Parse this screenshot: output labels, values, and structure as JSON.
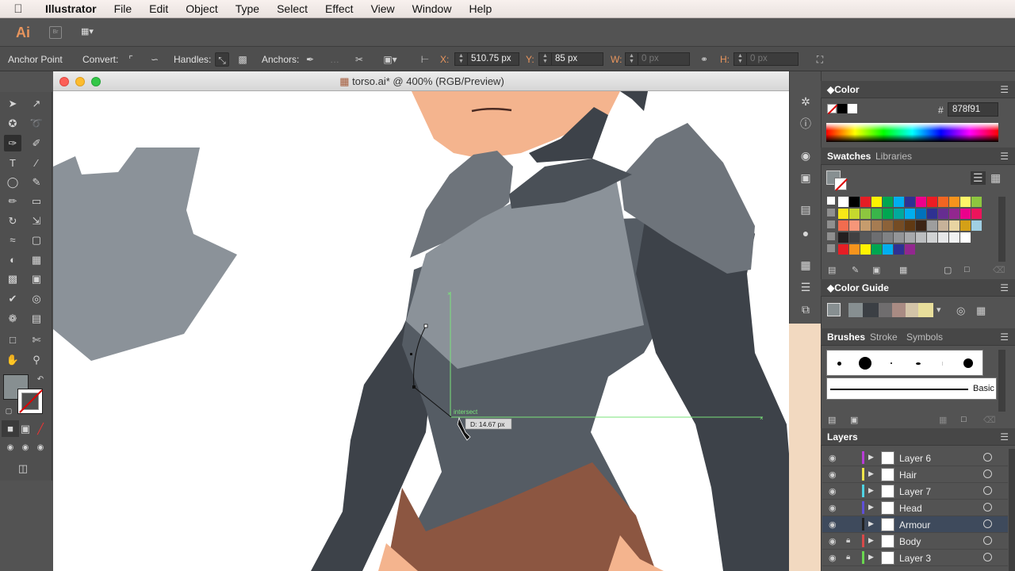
{
  "menubar": {
    "app": "Illustrator",
    "items": [
      "File",
      "Edit",
      "Object",
      "Type",
      "Select",
      "Effect",
      "View",
      "Window",
      "Help"
    ]
  },
  "appbar": {
    "logo": "Ai",
    "bridge": "Br"
  },
  "control": {
    "anchor_point": "Anchor Point",
    "convert": "Convert:",
    "handles": "Handles:",
    "anchors": "Anchors:",
    "x_label": "X:",
    "x_value": "510.75 px",
    "y_label": "Y:",
    "y_value": "85 px",
    "w_label": "W:",
    "w_value": "0 px",
    "h_label": "H:",
    "h_value": "0 px"
  },
  "document": {
    "title": "torso.ai* @ 400% (RGB/Preview)"
  },
  "canvas": {
    "smart_guide": "intersect",
    "measure": "D: 14.67 px",
    "colors": {
      "skin": "#f4b48e",
      "armor_dark": "#3d4249",
      "armor_mid": "#555c64",
      "armor_light": "#8b9299",
      "shorts": "#8c5641",
      "guide": "#7ae37a"
    }
  },
  "color_panel": {
    "title": "Color",
    "hex_label": "#",
    "hex_value": "878f91"
  },
  "swatches_panel": {
    "tab_active": "Swatches",
    "tab_other": "Libraries",
    "colors": [
      [
        "#ffffff",
        "#000000",
        "#e51e25",
        "#fff200",
        "#00a651",
        "#00aeef",
        "#2e3192",
        "#ec008c",
        "#ed1c24",
        "#f26522",
        "#f7941d",
        "#fff568",
        "#8dc63f"
      ],
      [
        "#f7e717",
        "#c5d92d",
        "#8dc63f",
        "#39b54a",
        "#00a651",
        "#00a99d",
        "#00aeef",
        "#0072bc",
        "#2e3192",
        "#662d91",
        "#92278f",
        "#ec008c",
        "#ed145b"
      ],
      [
        "#f26c4f",
        "#f69679",
        "#c69c6d",
        "#a67c52",
        "#8c6239",
        "#754c24",
        "#603913",
        "#3c2415",
        "#9e9e9e",
        "#c7b299",
        "#e8d4a2",
        "#d4a017",
        "#a0cfe3"
      ],
      [
        "#231f20",
        "#414042",
        "#58595b",
        "#6d6e71",
        "#808285",
        "#939598",
        "#a7a9ac",
        "#bcbec0",
        "#d1d3d4",
        "#e6e7e8",
        "#f1f2f2",
        "#ffffff"
      ],
      [
        "#e51e25",
        "#f7941d",
        "#fff200",
        "#00a651",
        "#00aeef",
        "#2e3192",
        "#92278f"
      ]
    ]
  },
  "color_guide": {
    "title": "Color Guide"
  },
  "brushes": {
    "tab_active": "Brushes",
    "tab2": "Stroke",
    "tab3": "Symbols",
    "basic": "Basic"
  },
  "layers": {
    "title": "Layers",
    "items": [
      {
        "name": "Layer 6",
        "color": "#b83cd6",
        "locked": false,
        "selected": false
      },
      {
        "name": "Hair",
        "color": "#f0e64a",
        "locked": false,
        "selected": false
      },
      {
        "name": "Layer 7",
        "color": "#4fd3e4",
        "locked": false,
        "selected": false
      },
      {
        "name": "Head",
        "color": "#5f4fd8",
        "locked": false,
        "selected": false
      },
      {
        "name": "Armour",
        "color": "#222222",
        "locked": false,
        "selected": true
      },
      {
        "name": "Body",
        "color": "#d84a4a",
        "locked": true,
        "selected": false
      },
      {
        "name": "Layer 3",
        "color": "#6ad64f",
        "locked": true,
        "selected": false
      }
    ]
  }
}
